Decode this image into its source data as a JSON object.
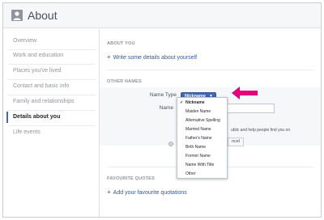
{
  "header": {
    "title": "About",
    "icon": "person-icon"
  },
  "sidebar": {
    "items": [
      {
        "label": "Overview"
      },
      {
        "label": "Work and education"
      },
      {
        "label": "Places you've lived"
      },
      {
        "label": "Contact and basic info"
      },
      {
        "label": "Family and relationships"
      },
      {
        "label": "Details about you"
      },
      {
        "label": "Life events"
      }
    ],
    "active_index": 5
  },
  "main": {
    "about_you": {
      "heading": "ABOUT YOU",
      "link": "Write some details about yourself"
    },
    "other_names": {
      "heading": "OTHER NAMES",
      "name_type_label": "Name Type",
      "name_type_value": "Nickname",
      "name_label": "Name",
      "help_text": "ublic and help people find you on",
      "cancel_label": "ncel"
    },
    "favourite_quotes": {
      "heading": "FAVOURITE QUOTES",
      "link": "Add your favourite quotations"
    }
  },
  "dropdown": {
    "options": [
      "Nickname",
      "Maiden Name",
      "Alternative Spelling",
      "Married Name",
      "Father's Name",
      "Birth Name",
      "Former Name",
      "Name With Title",
      "Other"
    ],
    "selected_index": 0
  },
  "colors": {
    "accent": "#4267b2",
    "link": "#365899",
    "arrow": "#e6007e",
    "muted": "#90949c"
  }
}
